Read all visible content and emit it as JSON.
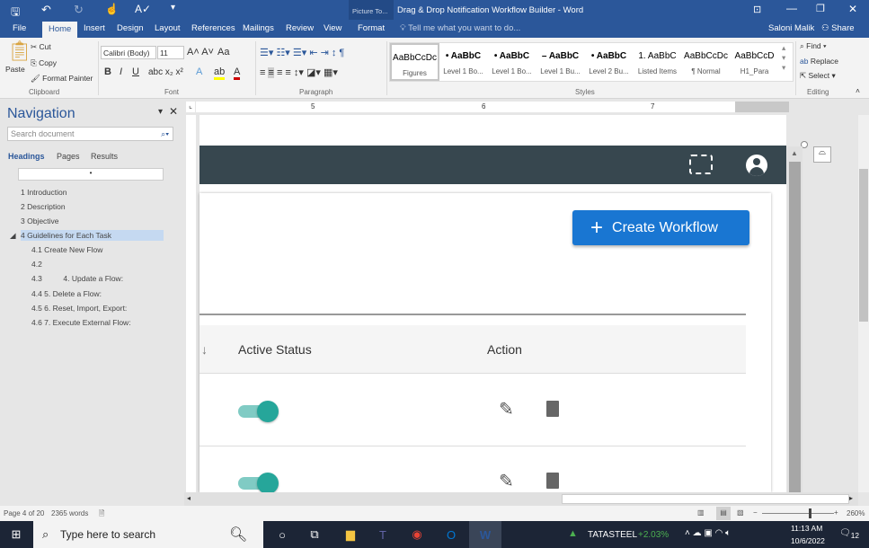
{
  "window": {
    "title": "Drag & Drop Notification Workflow Builder - Word",
    "context_tab_group": "Picture To...",
    "user": "Saloni Malik",
    "share": "Share",
    "tell_me": "Tell me what you want to do..."
  },
  "tabs": [
    "File",
    "Home",
    "Insert",
    "Design",
    "Layout",
    "References",
    "Mailings",
    "Review",
    "View",
    "Format"
  ],
  "ribbon": {
    "clipboard": {
      "paste": "Paste",
      "cut": "Cut",
      "copy": "Copy",
      "format_painter": "Format Painter",
      "label": "Clipboard"
    },
    "font": {
      "name": "Calibri (Body)",
      "size": "11",
      "label": "Font",
      "bold": "B",
      "italic": "I",
      "underline": "U",
      "change_case": "Aa"
    },
    "paragraph": {
      "label": "Paragraph"
    },
    "styles": {
      "label": "Styles",
      "items": [
        {
          "preview": "AaBbCcDc",
          "name": "Figures"
        },
        {
          "preview": "• AaBbC",
          "name": "Level 1 Bo..."
        },
        {
          "preview": "• AaBbC",
          "name": "Level 1 Bo..."
        },
        {
          "preview": "– AaBbC",
          "name": "Level 1 Bu..."
        },
        {
          "preview": "• AaBbC",
          "name": "Level 2 Bu..."
        },
        {
          "preview": "1. AaBbC",
          "name": "Listed Items"
        },
        {
          "preview": "AaBbCcDc",
          "name": "¶ Normal"
        },
        {
          "preview": "AaBbCcD",
          "name": "H1_Para"
        }
      ]
    },
    "editing": {
      "find": "Find",
      "replace": "Replace",
      "select": "Select",
      "label": "Editing"
    }
  },
  "navigation": {
    "title": "Navigation",
    "search_placeholder": "Search document",
    "tabs": [
      "Headings",
      "Pages",
      "Results"
    ],
    "headings": [
      "1 Introduction",
      "2 Description",
      "3 Objective",
      "4 Guidelines for Each Task",
      "4.1 Create New Flow",
      "4.2",
      "4.3          4. Update a Flow:",
      "4.4 5. Delete a Flow:",
      "4.5 6. Reset, Import, Export:",
      "4.6 7. Execute External Flow:"
    ]
  },
  "ruler": {
    "marks": [
      "5",
      "6",
      "7"
    ]
  },
  "document": {
    "create_button": "Create Workflow",
    "columns": [
      "Active Status",
      "Action"
    ],
    "rows": [
      {
        "active": true
      },
      {
        "active": true
      }
    ]
  },
  "status": {
    "page": "Page 4 of 20",
    "words": "2365 words",
    "zoom": "260%"
  },
  "taskbar": {
    "search": "Type here to search",
    "stock": "TATASTEEL",
    "stock_change": "+2.03%",
    "time": "11:13 AM",
    "date": "10/6/2022",
    "notifications": "12"
  },
  "colors": {
    "word_blue": "#2b579a",
    "app_bar": "#37474f",
    "button": "#1976d2",
    "toggle": "#26a69a",
    "stock_up": "#4caf50"
  }
}
